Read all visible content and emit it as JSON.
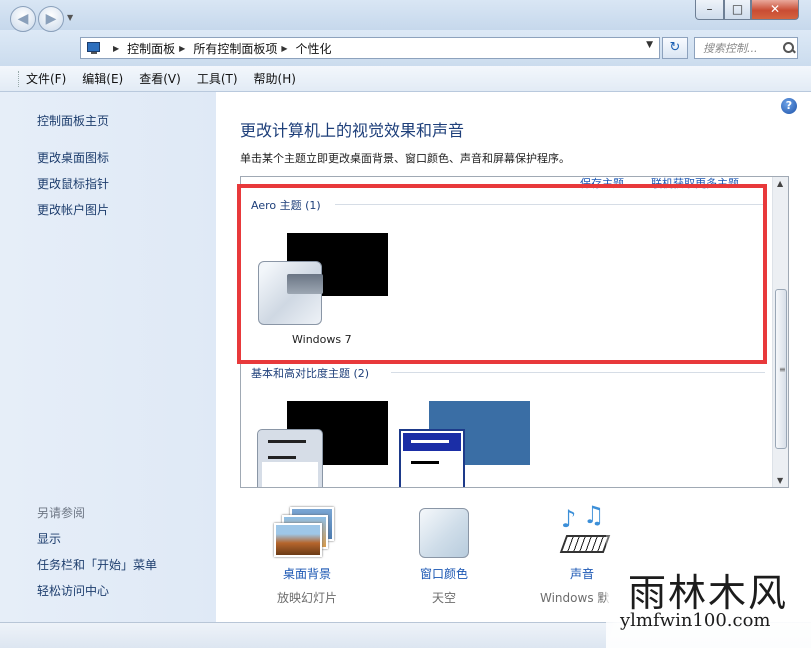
{
  "address": {
    "crumbs": [
      "控制面板",
      "所有控制面板项",
      "个性化"
    ]
  },
  "search": {
    "placeholder": "搜索控制..."
  },
  "menu": {
    "items": [
      "文件(F)",
      "编辑(E)",
      "查看(V)",
      "工具(T)",
      "帮助(H)"
    ]
  },
  "left_pane": {
    "links": [
      "控制面板主页",
      "更改桌面图标",
      "更改鼠标指针",
      "更改帐户图片"
    ],
    "see_also_title": "另请参阅",
    "see_also": [
      "显示",
      "任务栏和「开始」菜单",
      "轻松访问中心"
    ]
  },
  "content": {
    "title": "更改计算机上的视觉效果和声音",
    "description": "单击某个主题立即更改桌面背景、窗口颜色、声音和屏幕保护程序。",
    "save_theme": "保存主题",
    "online_themes": "联机获取更多主题",
    "groups": [
      {
        "title": "Aero 主题 (1)",
        "themes": [
          "Windows 7"
        ]
      },
      {
        "title": "基本和高对比度主题 (2)"
      }
    ]
  },
  "tiles": [
    {
      "label": "桌面背景",
      "sub": "放映幻灯片",
      "icon": "desktop-background-icon"
    },
    {
      "label": "窗口颜色",
      "sub": "天空",
      "icon": "window-color-icon"
    },
    {
      "label": "声音",
      "sub": "Windows 默",
      "icon": "sound-icon"
    }
  ],
  "watermark": {
    "title": "雨林木风",
    "url": "ylmfwin100.com"
  },
  "colors": {
    "highlight": "#e8393b",
    "link": "#1a56b3",
    "title": "#1e3f7a"
  }
}
